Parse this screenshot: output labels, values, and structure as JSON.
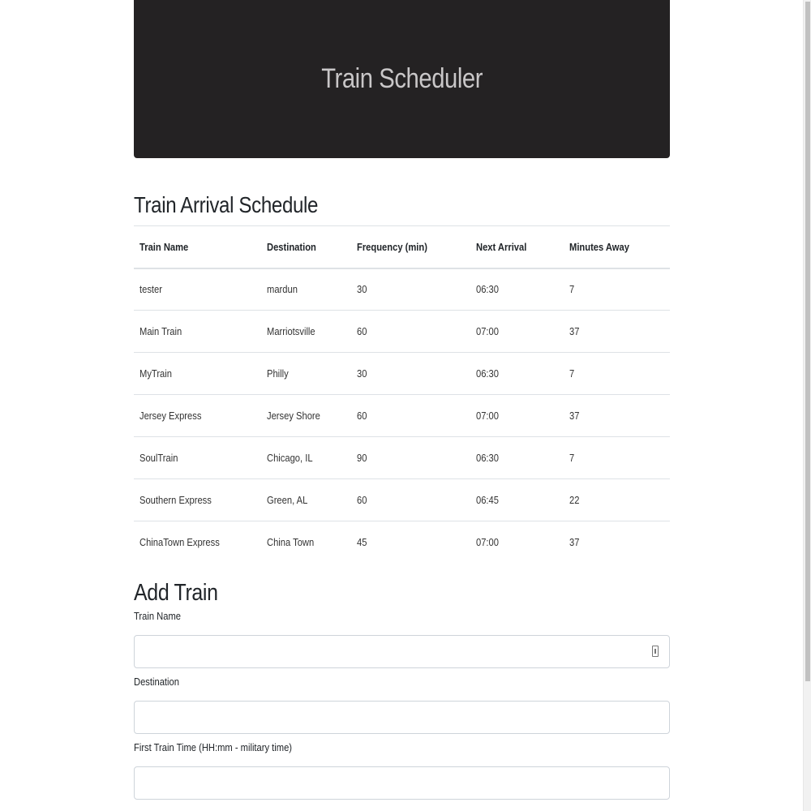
{
  "header": {
    "title": "Train Scheduler"
  },
  "schedule": {
    "title": "Train Arrival Schedule",
    "columns": [
      "Train Name",
      "Destination",
      "Frequency (min)",
      "Next Arrival",
      "Minutes Away"
    ],
    "rows": [
      [
        "tester",
        "mardun",
        "30",
        "06:30",
        "7"
      ],
      [
        "Main Train",
        "Marriotsville",
        "60",
        "07:00",
        "37"
      ],
      [
        "MyTrain",
        "Philly",
        "30",
        "06:30",
        "7"
      ],
      [
        "Jersey Express",
        "Jersey Shore",
        "60",
        "07:00",
        "37"
      ],
      [
        "SoulTrain",
        "Chicago, IL",
        "90",
        "06:30",
        "7"
      ],
      [
        "Southern Express",
        "Green, AL",
        "60",
        "06:45",
        "22"
      ],
      [
        "ChinaTown Express",
        "China Town",
        "45",
        "07:00",
        "37"
      ]
    ]
  },
  "form": {
    "title": "Add Train",
    "train_name_label": "Train Name",
    "train_name_value": "",
    "destination_label": "Destination",
    "destination_value": "",
    "first_train_label": "First Train Time (HH:mm - military time)",
    "first_train_value": ""
  },
  "icons": {
    "autofill": "autofill-key-icon"
  },
  "colors": {
    "jumbotron_bg": "#242223",
    "jumbotron_text": "#c9c7c8"
  }
}
